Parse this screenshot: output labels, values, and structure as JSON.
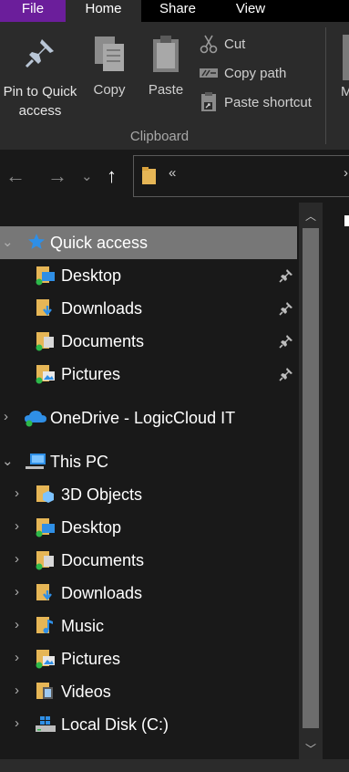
{
  "tabs": [
    "File",
    "Home",
    "Share",
    "View"
  ],
  "ribbon": {
    "pin_label": "Pin to Quick access",
    "copy_label": "Copy",
    "paste_label": "Paste",
    "cut_label": "Cut",
    "copy_path_label": "Copy path",
    "paste_shortcut_label": "Paste shortcut",
    "group_label": "Clipboard",
    "next_group_partial": "M"
  },
  "address": {
    "chevron": "«",
    "edge_glyph": "›"
  },
  "nav": {
    "quick_access": "Quick access",
    "quick_items": [
      "Desktop",
      "Downloads",
      "Documents",
      "Pictures"
    ],
    "onedrive": "OneDrive - LogicCloud IT",
    "this_pc": "This PC",
    "pc_items": [
      "3D Objects",
      "Desktop",
      "Documents",
      "Downloads",
      "Music",
      "Pictures",
      "Videos",
      "Local Disk (C:)"
    ]
  },
  "colors": {
    "file_tab": "#6b1e9b",
    "ribbon_bg": "#2b2b2b",
    "pane_bg": "#191919",
    "selected": "#777777",
    "folder": "#e6b656",
    "accent_blue": "#2f8fe6"
  }
}
